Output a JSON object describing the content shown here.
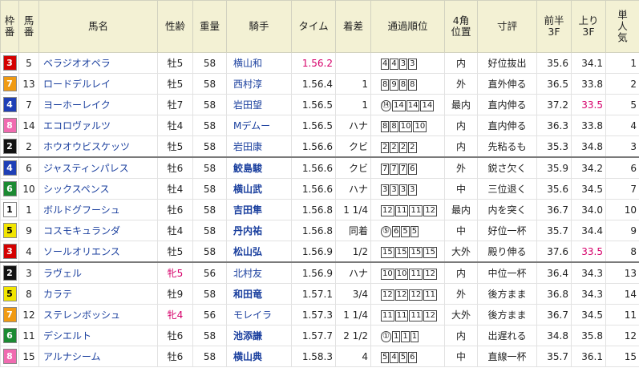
{
  "headers": {
    "waku": [
      "枠",
      "番"
    ],
    "umaban": [
      "馬",
      "番"
    ],
    "name": "馬名",
    "sexage": "性齢",
    "weight": "重量",
    "jockey": "騎手",
    "time": "タイム",
    "margin": "着差",
    "passing": "通過順位",
    "corner4": [
      "4角",
      "位置"
    ],
    "comment": "寸評",
    "first3f": [
      "前半",
      "3F"
    ],
    "last3f": [
      "上り",
      "3F"
    ],
    "pop": [
      "単",
      "人",
      "気"
    ]
  },
  "rows": [
    {
      "waku": "3",
      "num": "5",
      "name": "ベラジオオペラ",
      "sexage": "牡5",
      "weight": "58",
      "jockey": "横山和",
      "time": "1.56.2",
      "margin": "",
      "pass": [
        "4",
        "4",
        "3",
        "3"
      ],
      "corner": "内",
      "comment": "好位抜出",
      "first3f": "35.6",
      "last3f": "34.1",
      "pop": "1"
    },
    {
      "waku": "7",
      "num": "13",
      "name": "ロードデルレイ",
      "sexage": "牡5",
      "weight": "58",
      "jockey": "西村淳",
      "time": "1.56.4",
      "margin": "1",
      "pass": [
        "8",
        "9",
        "8",
        "8"
      ],
      "corner": "外",
      "comment": "直外伸る",
      "first3f": "36.5",
      "last3f": "33.8",
      "pop": "2"
    },
    {
      "waku": "4",
      "num": "7",
      "name": "ヨーホーレイク",
      "sexage": "牡7",
      "weight": "58",
      "jockey": "岩田望",
      "time": "1.56.5",
      "margin": "1",
      "pass": [
        "⑭",
        "14",
        "14",
        "14"
      ],
      "corner": "最内",
      "comment": "直内伸る",
      "first3f": "37.2",
      "last3f": "33.5",
      "pop": "5"
    },
    {
      "waku": "8",
      "num": "14",
      "name": "エコロヴァルツ",
      "sexage": "牡4",
      "weight": "58",
      "jockey": "Mデムー",
      "time": "1.56.5",
      "margin": "ハナ",
      "pass": [
        "8",
        "8",
        "10",
        "10"
      ],
      "corner": "内",
      "comment": "直内伸る",
      "first3f": "36.3",
      "last3f": "33.8",
      "pop": "4"
    },
    {
      "waku": "2",
      "num": "2",
      "name": "ホウオウビスケッツ",
      "sexage": "牡5",
      "weight": "58",
      "jockey": "岩田康",
      "time": "1.56.6",
      "margin": "クビ",
      "pass": [
        "2",
        "2",
        "2",
        "2"
      ],
      "corner": "内",
      "comment": "先粘るも",
      "first3f": "35.3",
      "last3f": "34.8",
      "pop": "3"
    },
    {
      "waku": "4",
      "num": "6",
      "name": "ジャスティンパレス",
      "sexage": "牡6",
      "weight": "58",
      "jockey": "鮫島駿",
      "time": "1.56.6",
      "margin": "クビ",
      "pass": [
        "7",
        "7",
        "7",
        "6"
      ],
      "corner": "外",
      "comment": "鋭さ欠く",
      "first3f": "35.9",
      "last3f": "34.2",
      "pop": "6"
    },
    {
      "waku": "6",
      "num": "10",
      "name": "シックスペンス",
      "sexage": "牡4",
      "weight": "58",
      "jockey": "横山武",
      "time": "1.56.6",
      "margin": "ハナ",
      "pass": [
        "3",
        "3",
        "3",
        "3"
      ],
      "corner": "中",
      "comment": "三位退く",
      "first3f": "35.6",
      "last3f": "34.5",
      "pop": "7"
    },
    {
      "waku": "1",
      "num": "1",
      "name": "ボルドグフーシュ",
      "sexage": "牡6",
      "weight": "58",
      "jockey": "吉田隼",
      "time": "1.56.8",
      "margin": "1 1/4",
      "pass": [
        "12",
        "11",
        "11",
        "12"
      ],
      "corner": "最内",
      "comment": "内を突く",
      "first3f": "36.7",
      "last3f": "34.0",
      "pop": "10"
    },
    {
      "waku": "5",
      "num": "9",
      "name": "コスモキュランダ",
      "sexage": "牡4",
      "weight": "58",
      "jockey": "丹内祐",
      "time": "1.56.8",
      "margin": "同着",
      "pass": [
        "⑤",
        "6",
        "5",
        "5"
      ],
      "corner": "中",
      "comment": "好位一杯",
      "first3f": "35.7",
      "last3f": "34.4",
      "pop": "9"
    },
    {
      "waku": "3",
      "num": "4",
      "name": "ソールオリエンス",
      "sexage": "牡5",
      "weight": "58",
      "jockey": "松山弘",
      "time": "1.56.9",
      "margin": "1/2",
      "pass": [
        "15",
        "15",
        "15",
        "15"
      ],
      "corner": "大外",
      "comment": "殿り伸る",
      "first3f": "37.6",
      "last3f": "33.5",
      "pop": "8"
    },
    {
      "waku": "2",
      "num": "3",
      "name": "ラヴェル",
      "sexage": "牝5",
      "weight": "56",
      "jockey": "北村友",
      "time": "1.56.9",
      "margin": "ハナ",
      "pass": [
        "10",
        "10",
        "11",
        "12"
      ],
      "corner": "内",
      "comment": "中位一杯",
      "first3f": "36.4",
      "last3f": "34.3",
      "pop": "13"
    },
    {
      "waku": "5",
      "num": "8",
      "name": "カラテ",
      "sexage": "牡9",
      "weight": "58",
      "jockey": "和田竜",
      "time": "1.57.1",
      "margin": "3/4",
      "pass": [
        "12",
        "12",
        "12",
        "11"
      ],
      "corner": "外",
      "comment": "後方まま",
      "first3f": "36.8",
      "last3f": "34.3",
      "pop": "14"
    },
    {
      "waku": "7",
      "num": "12",
      "name": "ステレンボッシュ",
      "sexage": "牝4",
      "weight": "56",
      "jockey": "モレイラ",
      "time": "1.57.3",
      "margin": "1 1/4",
      "pass": [
        "11",
        "11",
        "11",
        "12"
      ],
      "corner": "大外",
      "comment": "後方まま",
      "first3f": "36.7",
      "last3f": "34.5",
      "pop": "11"
    },
    {
      "waku": "6",
      "num": "11",
      "name": "デシエルト",
      "sexage": "牡6",
      "weight": "58",
      "jockey": "池添謙",
      "time": "1.57.7",
      "margin": "2 1/2",
      "pass": [
        "①",
        "1",
        "1",
        "1"
      ],
      "corner": "内",
      "comment": "出遅れる",
      "first3f": "34.8",
      "last3f": "35.8",
      "pop": "12"
    },
    {
      "waku": "8",
      "num": "15",
      "name": "アルナシーム",
      "sexage": "牡6",
      "weight": "58",
      "jockey": "横山典",
      "time": "1.58.3",
      "margin": "4",
      "pass": [
        "5",
        "4",
        "5",
        "6"
      ],
      "corner": "中",
      "comment": "直線一杯",
      "first3f": "35.7",
      "last3f": "36.1",
      "pop": "15"
    }
  ],
  "styles": {
    "fast_time_color": "#d6006a",
    "fast_last3f_color": "#d6006a",
    "filly_color": "#d6006a",
    "bold_jockeys": [
      "鮫島駿",
      "横山武",
      "吉田隼",
      "丹内祐",
      "松山弘",
      "和田竜",
      "池添謙",
      "横山典"
    ],
    "separator_after_rows": [
      5,
      10
    ]
  }
}
